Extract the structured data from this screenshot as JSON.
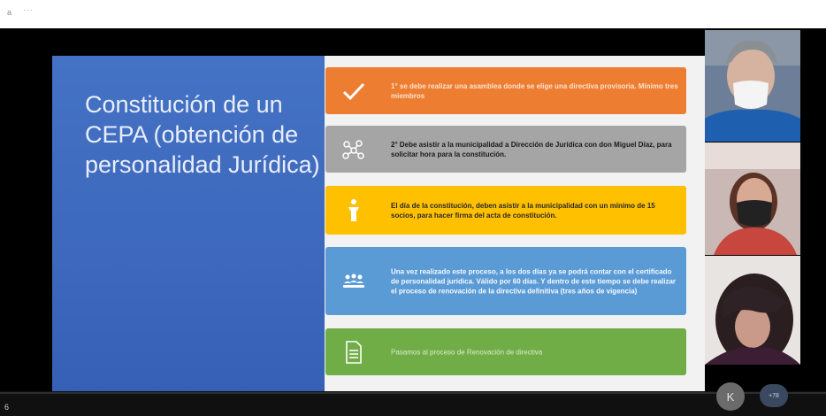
{
  "topbar": {
    "app_letter": "a",
    "menu_dots": "···"
  },
  "slide": {
    "title": "Constitución de un CEPA (obtención de personalidad Jurídica)",
    "steps": [
      {
        "icon": "checkmark-icon",
        "text": "1° se debe realizar una asamblea donde se elige una directiva provisoria. Mínimo tres miembros"
      },
      {
        "icon": "network-icon",
        "text": "2° Debe asistir a la municipalidad a Dirección de Jurídica con don Miguel Díaz, para solicitar hora para la constitución."
      },
      {
        "icon": "speaker-podium-icon",
        "text": "El día de la constitución, deben asistir a la municipalidad con un mínimo de 15 socios, para hacer firma del acta de constitución."
      },
      {
        "icon": "group-icon",
        "text": "Una vez realizado este proceso, a los dos días ya se podrá contar con el certificado de personalidad jurídica. Válido por 60 días. Y dentro de este tiempo se debe realizar el proceso de renovación de la directiva definitiva (tres años de vigencia)"
      },
      {
        "icon": "document-icon",
        "text": "Pasamos al proceso de Renovación de directiva"
      }
    ]
  },
  "footer": {
    "page_number": "6",
    "avatar_initial": "K",
    "more_label": "+78"
  },
  "colors": {
    "blue": "#4472c4",
    "orange": "#ed7d31",
    "gray": "#a5a5a5",
    "yellow": "#ffc000",
    "lightblue": "#5b9bd5",
    "green": "#70ad47"
  }
}
